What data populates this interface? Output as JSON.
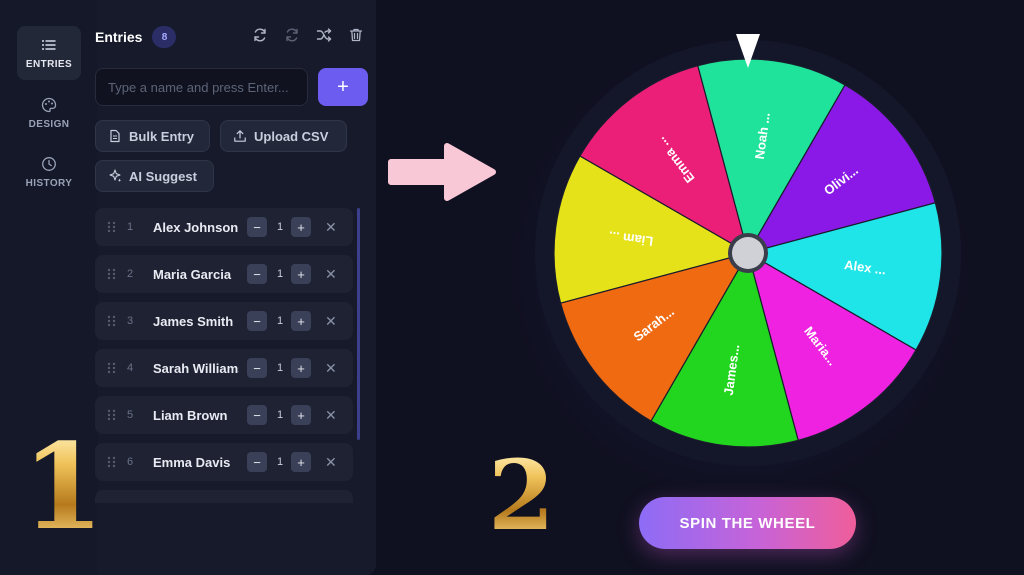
{
  "rail": {
    "items": [
      {
        "label": "ENTRIES",
        "icon": "list-icon",
        "active": true
      },
      {
        "label": "DESIGN",
        "icon": "palette-icon",
        "active": false
      },
      {
        "label": "HISTORY",
        "icon": "clock-icon",
        "active": false
      }
    ]
  },
  "panel": {
    "title": "Entries",
    "count": "8",
    "input_placeholder": "Type a name and press Enter...",
    "add_label": "+",
    "bulk_entry": "Bulk Entry",
    "upload_csv": "Upload CSV",
    "ai_suggest": "AI Suggest"
  },
  "entries": [
    {
      "num": "1",
      "name": "Alex Johnson",
      "weight": "1"
    },
    {
      "num": "2",
      "name": "Maria Garcia",
      "weight": "1"
    },
    {
      "num": "3",
      "name": "James Smith",
      "weight": "1"
    },
    {
      "num": "4",
      "name": "Sarah Williams",
      "weight": "1"
    },
    {
      "num": "5",
      "name": "Liam Brown",
      "weight": "1"
    },
    {
      "num": "6",
      "name": "Emma Davis",
      "weight": "1"
    }
  ],
  "stepper": {
    "minus": "−",
    "plus": "+",
    "remove": "✕"
  },
  "wheel": {
    "segments": [
      {
        "label": "Liam ...",
        "color": "#e6e21a"
      },
      {
        "label": "Emma ...",
        "color": "#ec1f78"
      },
      {
        "label": "Noah ...",
        "color": "#1fe39a"
      },
      {
        "label": "Olivi...",
        "color": "#8a18e6"
      },
      {
        "label": "Alex ...",
        "color": "#1fe5e8"
      },
      {
        "label": "Maria...",
        "color": "#ee22e0"
      },
      {
        "label": "James...",
        "color": "#22d61f"
      },
      {
        "label": "Sarah...",
        "color": "#f06a12"
      }
    ]
  },
  "spin_label": "SPIN THE WHEEL",
  "step_labels": {
    "one": "1",
    "two": "2"
  },
  "colors": {
    "accent": "#6d5cf0",
    "arrow": "#f9c8d6"
  }
}
